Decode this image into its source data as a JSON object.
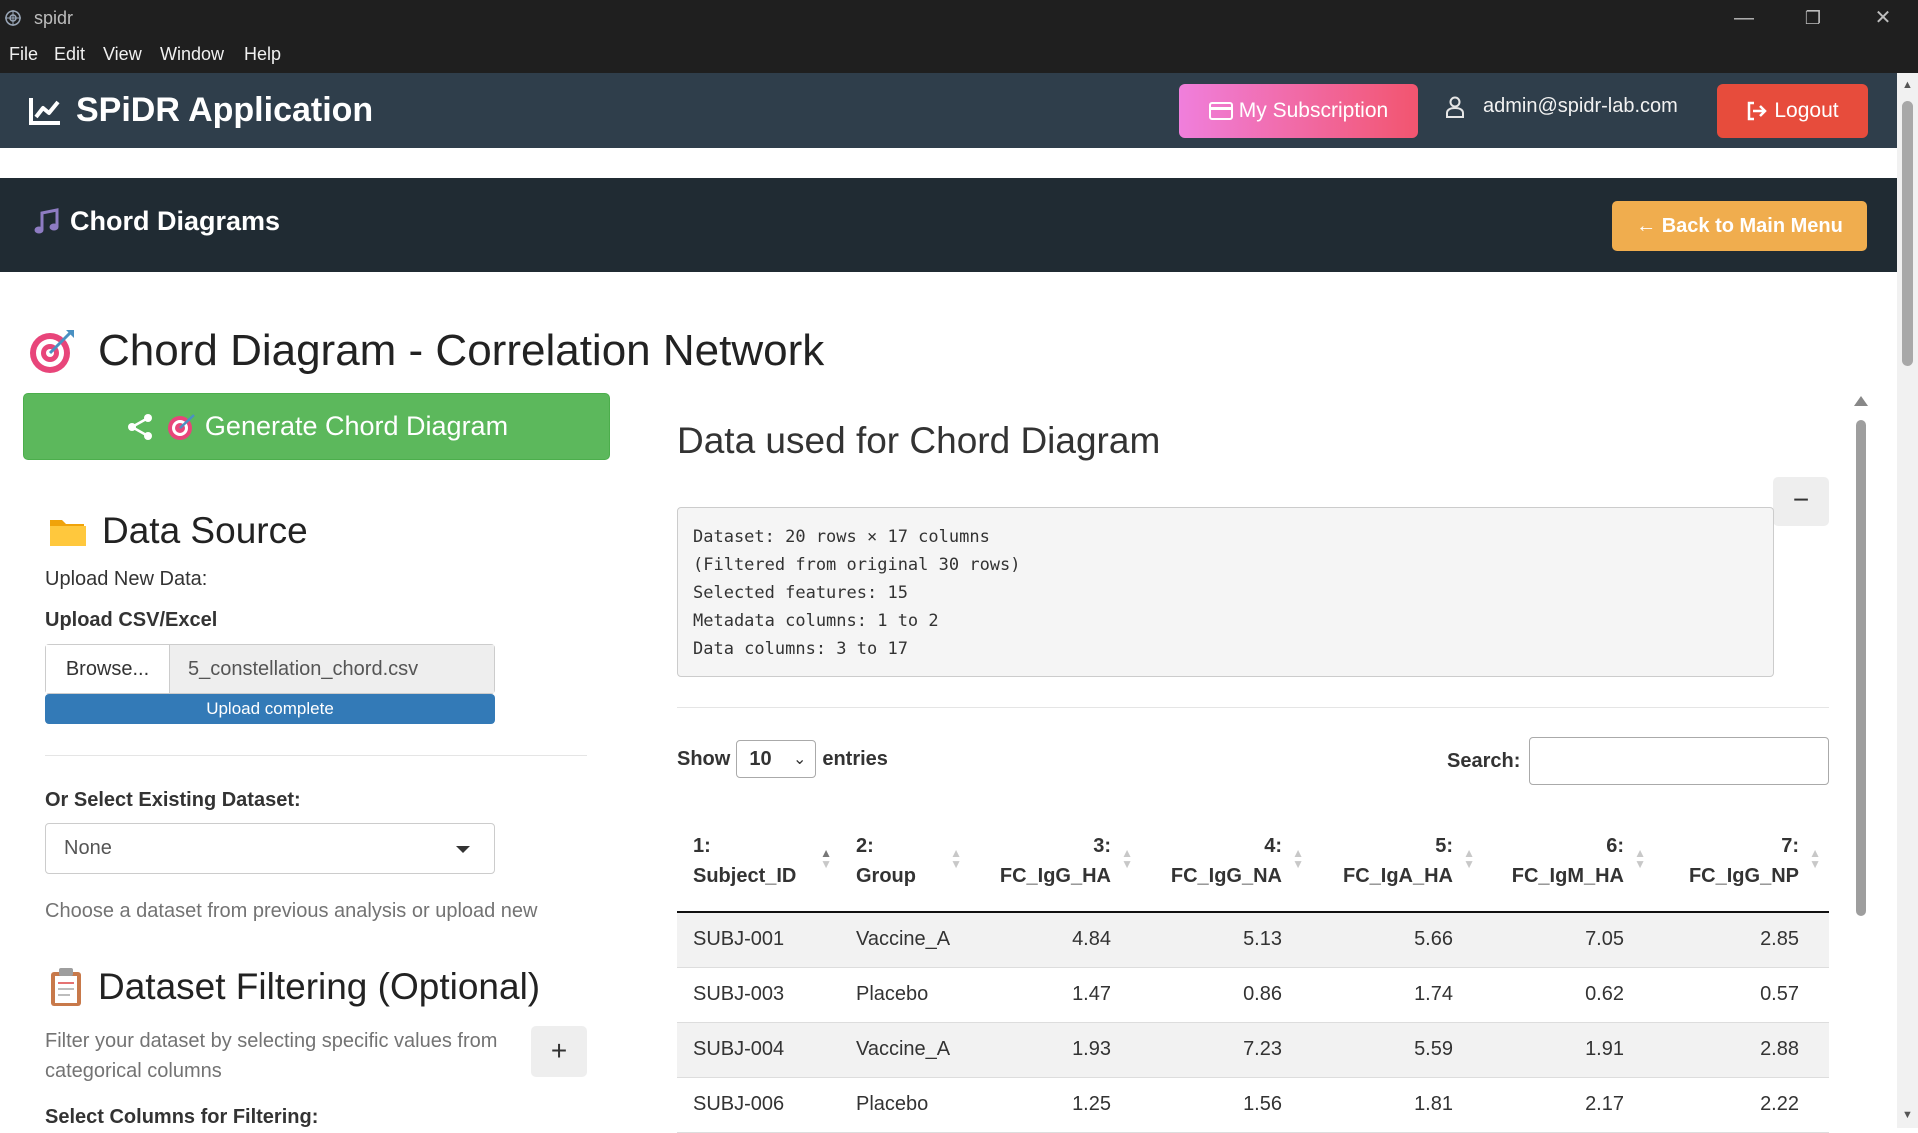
{
  "window": {
    "title": "spidr",
    "minimize": "—",
    "maximize": "❐",
    "close": "✕"
  },
  "menu": [
    "File",
    "Edit",
    "View",
    "Window",
    "Help"
  ],
  "navbar": {
    "brand": "SPiDR Application",
    "subscription_label": "My Subscription",
    "user_email": "admin@spidr-lab.com",
    "logout_label": "Logout"
  },
  "subheader": {
    "title": "Chord Diagrams",
    "back_label": "← Back to Main Menu"
  },
  "main": {
    "heading": "Chord Diagram - Correlation Network"
  },
  "left": {
    "generate_label": "Generate Chord Diagram",
    "data_source_title": "Data Source",
    "upload_new_label": "Upload New Data:",
    "upload_csv_label": "Upload CSV/Excel",
    "browse_label": "Browse...",
    "file_name": "5_constellation_chord.csv",
    "upload_status": "Upload complete",
    "existing_label": "Or Select Existing Dataset:",
    "existing_value": "None",
    "existing_help": "Choose a dataset from previous analysis or upload new",
    "filter_title": "Dataset Filtering (Optional)",
    "filter_help": "Filter your dataset by selecting specific values from categorical columns",
    "filter_add": "+",
    "filter_columns_label": "Select Columns for Filtering:"
  },
  "right": {
    "title": "Data used for Chord Diagram",
    "collapse": "−",
    "summary": [
      "Dataset: 20 rows × 17 columns",
      "(Filtered from original 30 rows)",
      "Selected features: 15",
      "Metadata columns: 1 to 2",
      "Data columns: 3 to 17"
    ],
    "show_label": "Show",
    "entries_value": "10",
    "entries_label": "entries",
    "search_label": "Search:",
    "columns": [
      {
        "num": "1:",
        "name": "Subject_ID"
      },
      {
        "num": "2:",
        "name": "Group"
      },
      {
        "num": "3:",
        "name": "FC_IgG_HA"
      },
      {
        "num": "4:",
        "name": "FC_IgG_NA"
      },
      {
        "num": "5:",
        "name": "FC_IgA_HA"
      },
      {
        "num": "6:",
        "name": "FC_IgM_HA"
      },
      {
        "num": "7:",
        "name": "FC_IgG_NP"
      }
    ],
    "rows": [
      [
        "SUBJ-001",
        "Vaccine_A",
        "4.84",
        "5.13",
        "5.66",
        "7.05",
        "2.85"
      ],
      [
        "SUBJ-003",
        "Placebo",
        "1.47",
        "0.86",
        "1.74",
        "0.62",
        "0.57"
      ],
      [
        "SUBJ-004",
        "Vaccine_A",
        "1.93",
        "7.23",
        "5.59",
        "1.91",
        "2.88"
      ],
      [
        "SUBJ-006",
        "Placebo",
        "1.25",
        "1.56",
        "1.81",
        "2.17",
        "2.22"
      ]
    ]
  }
}
